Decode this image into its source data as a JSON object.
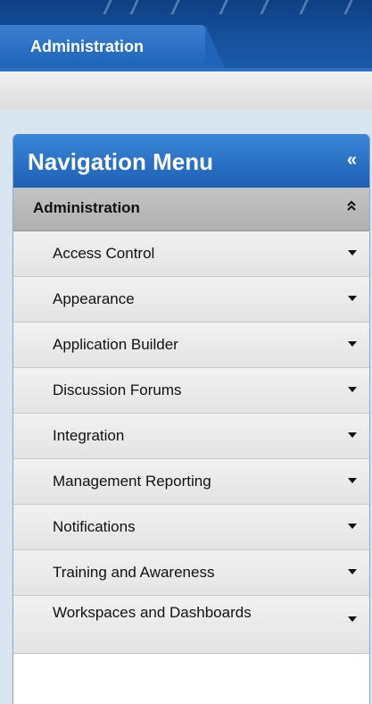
{
  "header": {
    "tab_label": "Administration"
  },
  "nav": {
    "title": "Navigation Menu",
    "collapse_icon": "«",
    "section": {
      "label": "Administration",
      "icon": "double-chevron-up-icon"
    },
    "items": [
      {
        "label": "Access Control"
      },
      {
        "label": "Appearance"
      },
      {
        "label": "Application Builder"
      },
      {
        "label": "Discussion Forums"
      },
      {
        "label": "Integration"
      },
      {
        "label": "Management Reporting"
      },
      {
        "label": "Notifications"
      },
      {
        "label": "Training and Awareness"
      },
      {
        "label": "Workspaces and Dashboards"
      }
    ]
  },
  "colors": {
    "brand_blue": "#1c60b5",
    "section_gray": "#b8b8b8",
    "item_gray": "#e8e8e8"
  }
}
